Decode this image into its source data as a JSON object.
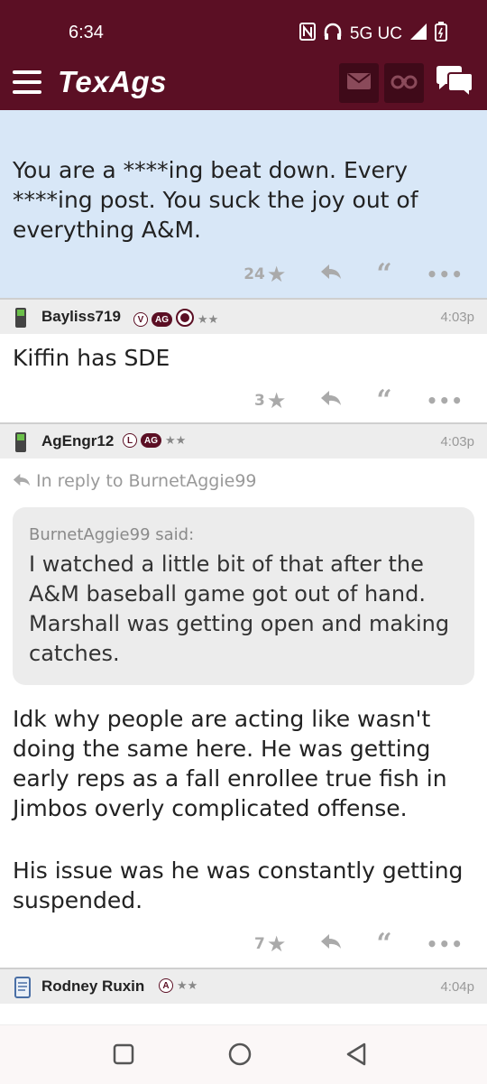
{
  "status_bar": {
    "time": "6:34",
    "network": "5G UC"
  },
  "app": {
    "logo": "TexAgs"
  },
  "posts": [
    {
      "text": "You are a ****ing beat down. Every ****ing post. You suck the joy out of everything A&M.",
      "stars": "24"
    },
    {
      "username": "Bayliss719",
      "badge_letter": "V",
      "badge_ag": "AG",
      "rank_stars": "★★",
      "time": "4:03p",
      "text": "Kiffin has SDE",
      "stars": "3"
    },
    {
      "username": "AgEngr12",
      "badge_letter": "L",
      "badge_ag": "AG",
      "rank_stars": "★★",
      "time": "4:03p",
      "reply_to": "In reply to BurnetAggie99",
      "quote_author": "BurnetAggie99 said:",
      "quote_text": "I watched a little bit of that after the A&M baseball game got out of hand. Marshall was getting open and making catches.",
      "text_p1": "Idk why people are acting like wasn't doing the same here. He was getting early reps as a fall enrollee true fish in Jimbos overly complicated offense.",
      "text_p2": "His issue was he was constantly getting suspended.",
      "stars": "7"
    },
    {
      "username": "Rodney Ruxin",
      "badge_letter": "A",
      "rank_stars": "★★",
      "time": "4:04p"
    }
  ]
}
